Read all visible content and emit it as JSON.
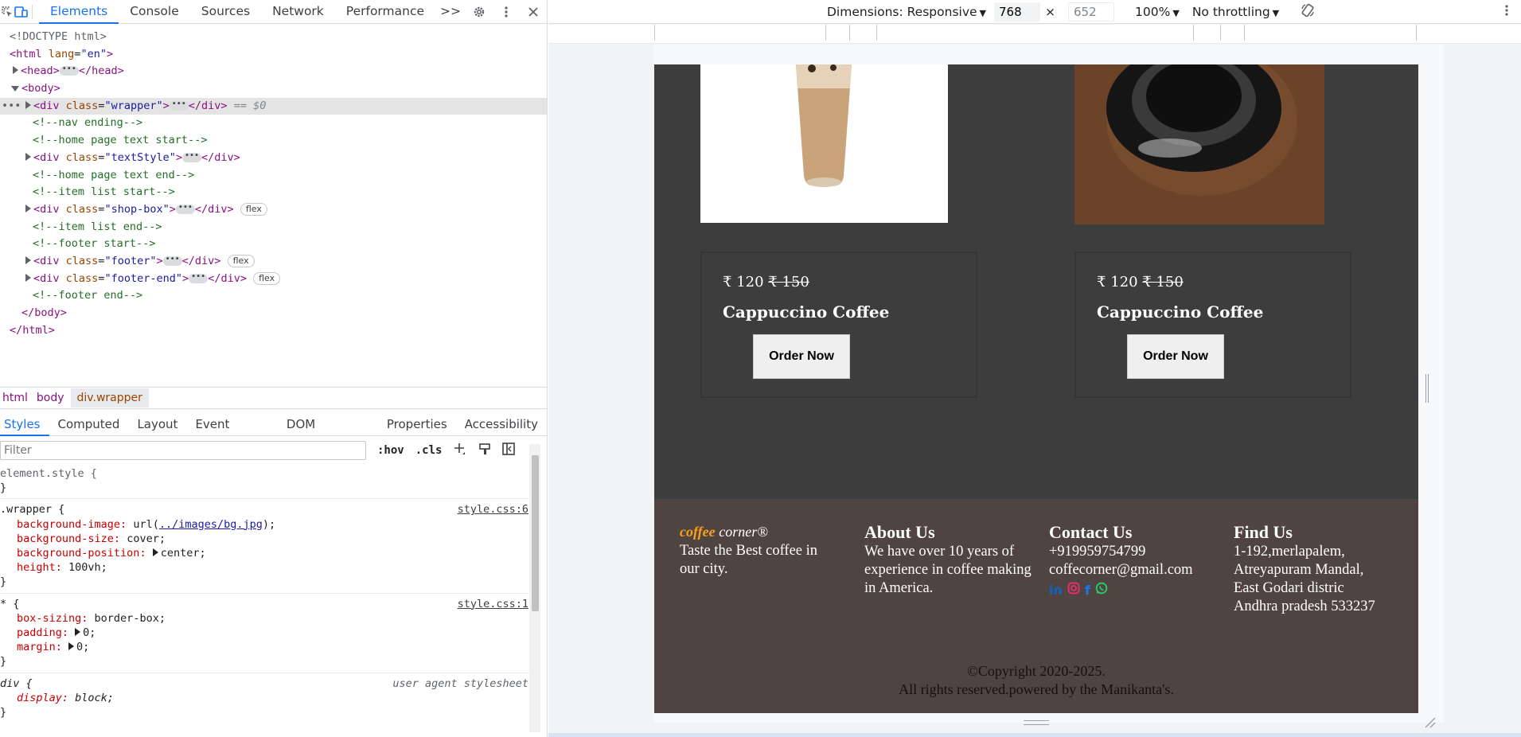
{
  "devtools": {
    "tabs": [
      "Elements",
      "Console",
      "Sources",
      "Network",
      "Performance"
    ],
    "overflow_label": ">>",
    "tree": {
      "doctype": "<!DOCTYPE html>",
      "html_open": "<html",
      "html_attr": "lang",
      "html_val": "\"en\"",
      "head": "<head>",
      "head_close": "</head>",
      "body": "<body>",
      "wrapper_class": "\"wrapper\"",
      "eq0": "== $0",
      "c_nav_end": "<!--nav ending-->",
      "c_home_start": "<!--home page text start-->",
      "textstyle_class": "\"textStyle\"",
      "c_home_end": "<!--home page text end-->",
      "c_item_start": "<!--item list start-->",
      "shopbox_class": "\"shop-box\"",
      "c_item_end": "<!--item list end-->",
      "c_footer_start": "<!--footer start-->",
      "footer_class": "\"footer\"",
      "footerend_class": "\"footer-end\"",
      "c_footer_end": "<!--footer end-->",
      "body_close": "</body>",
      "html_close": "</html>",
      "flex_badge": "flex",
      "div_open": "<div",
      "div_close": "</div>",
      "class_attr": "class"
    },
    "breadcrumbs": [
      "html",
      "body",
      "div.wrapper"
    ],
    "subtabs": [
      "Styles",
      "Computed",
      "Layout",
      "Event Listeners",
      "DOM Breakpoints",
      "Properties",
      "Accessibility"
    ],
    "filter_placeholder": "Filter",
    "hov_label": ":hov",
    "cls_label": ".cls",
    "styles": {
      "element_style": "element.style {",
      "close": "}",
      "wrapper_sel": ".wrapper {",
      "wrapper_src": "style.css:6",
      "bg_image_prop": "background-image",
      "bg_image_url": "../images/bg.jpg",
      "bg_size_prop": "background-size",
      "bg_size_val": "cover;",
      "bg_pos_prop": "background-position",
      "bg_pos_val": "center;",
      "height_prop": "height",
      "height_val": "100vh;",
      "star_sel": "* {",
      "star_src": "style.css:1",
      "box_sizing_prop": "box-sizing",
      "box_sizing_val": "border-box;",
      "padding_prop": "padding",
      "padding_val": "0;",
      "margin_prop": "margin",
      "margin_val": "0;",
      "div_sel": "div {",
      "ua_src": "user agent stylesheet",
      "display_prop": "display",
      "display_val": "block;"
    }
  },
  "device_toolbar": {
    "dimensions_label": "Dimensions: Responsive",
    "width": "768",
    "height": "652",
    "zoom": "100%",
    "throttling": "No throttling"
  },
  "site": {
    "cards": [
      {
        "currency": "₹",
        "price": "120",
        "old_price": "₹ 150",
        "title": "Cappuccino Coffee",
        "button": "Order Now"
      },
      {
        "currency": "₹",
        "price": "120",
        "old_price": "₹ 150",
        "title": "Cappuccino Coffee",
        "button": "Order Now"
      }
    ],
    "footer": {
      "brand_coffee": "coffee",
      "brand_corner": "corner®",
      "tagline": "Taste the Best coffee in our city.",
      "about_title": "About Us",
      "about_text": "We have over 10 years of experience in coffee making in America.",
      "contact_title": "Contact Us",
      "phone": "+919959754799",
      "email": "coffecorner@gmail.com",
      "social": {
        "linkedin": "in",
        "facebook": "f"
      },
      "find_title": "Find Us",
      "address1": "1-192,merlapalem,",
      "address2": "Atreyapuram Mandal,",
      "address3": "East Godari distric",
      "address4": "Andhra pradesh 533237",
      "copyright1": "©Copyright 2020-2025.",
      "copyright2": "All rights reserved.powered by the Manikanta's."
    },
    "colors": {
      "shop_bg": "#3d3d3d",
      "footer_bg": "#4f4441",
      "brand_orange": "#f7a21b",
      "linkedin": "#0a66c2",
      "instagram": "#e1306c",
      "facebook": "#1877f2",
      "whatsapp": "#25d366"
    }
  }
}
